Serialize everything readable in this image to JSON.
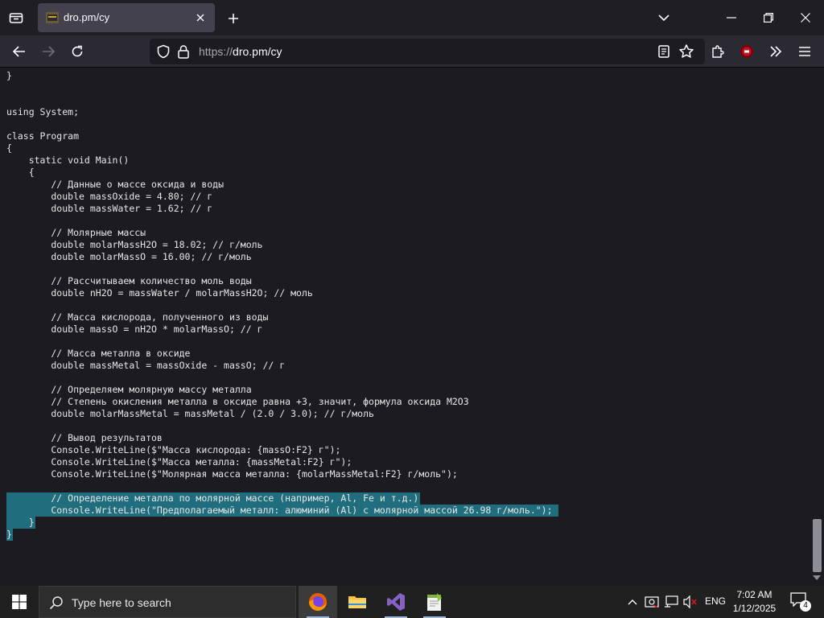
{
  "browser": {
    "tab": {
      "title": "dro.pm/cy"
    },
    "url": {
      "scheme": "https://",
      "rest": "dro.pm/cy"
    }
  },
  "code_lines": [
    "}",
    "",
    "",
    "using System;",
    "",
    "class Program",
    "{",
    "    static void Main()",
    "    {",
    "        // Данные о массе оксида и воды",
    "        double massOxide = 4.80; // г",
    "        double massWater = 1.62; // г",
    "",
    "        // Молярные массы",
    "        double molarMassH2O = 18.02; // г/моль",
    "        double molarMassO = 16.00; // г/моль",
    "",
    "        // Рассчитываем количество моль воды",
    "        double nH2O = massWater / molarMassH2O; // моль",
    "",
    "        // Масса кислорода, полученного из воды",
    "        double massO = nH2O * molarMassO; // г",
    "",
    "        // Масса металла в оксиде",
    "        double massMetal = massOxide - massO; // г",
    "",
    "        // Определяем молярную массу металла",
    "        // Степень окисления металла в оксиде равна +3, значит, формула оксида M2O3",
    "        double molarMassMetal = massMetal / (2.0 / 3.0); // г/моль",
    "",
    "        // Вывод результатов",
    "        Console.WriteLine($\"Масса кислорода: {massO:F2} г\");",
    "        Console.WriteLine($\"Масса металла: {massMetal:F2} г\");",
    "        Console.WriteLine($\"Молярная масса металла: {molarMassMetal:F2} г/моль\");",
    "",
    "        // Определение металла по молярной массе (например, Al, Fe и т.д.)",
    "        Console.WriteLine(\"Предполагаемый металл: алюминий (Al) с молярной массой 26.98 г/моль.\");",
    "    }",
    "}"
  ],
  "taskbar": {
    "search_placeholder": "Type here to search",
    "language": "ENG",
    "time": "7:02 AM",
    "date": "1/12/2025",
    "notification_count": "4"
  },
  "colors": {
    "selection": "#206e7d",
    "background": "#1c1b22"
  }
}
